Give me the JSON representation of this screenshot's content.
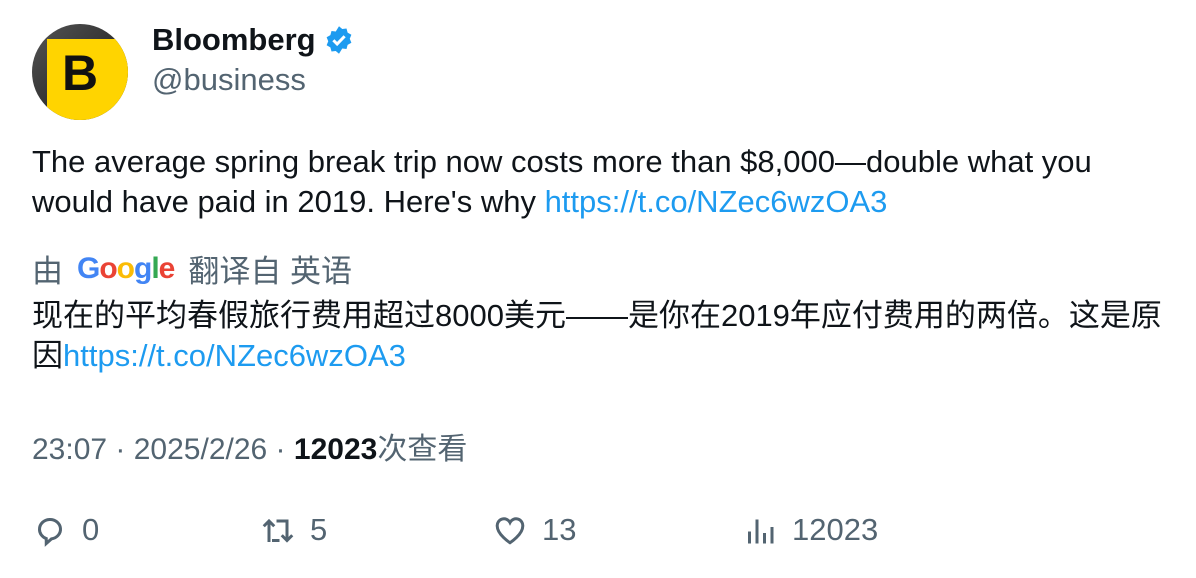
{
  "author": {
    "name": "Bloomberg",
    "handle": "@business",
    "avatar_letter": "B"
  },
  "tweet": {
    "text": "The average spring break trip now costs more than $8,000—double what you would have paid in 2019. Here's why ",
    "link": "https://t.co/NZec6wzOA3"
  },
  "translation": {
    "by": "由",
    "provider": "Google",
    "from": "翻译自 英语",
    "text": "现在的平均春假旅行费用超过8000美元——是你在2019年应付费用的两倍。这是原因",
    "link": "https://t.co/NZec6wzOA3"
  },
  "meta": {
    "time": "23:07",
    "date": "2025/2/26",
    "views": "12023",
    "views_label": "次查看"
  },
  "actions": {
    "replies": "0",
    "retweets": "5",
    "likes": "13",
    "views": "12023"
  },
  "colors": {
    "link": "#1d9bf0",
    "verified": "#1d9bf0",
    "avatar": "#ffd400"
  }
}
